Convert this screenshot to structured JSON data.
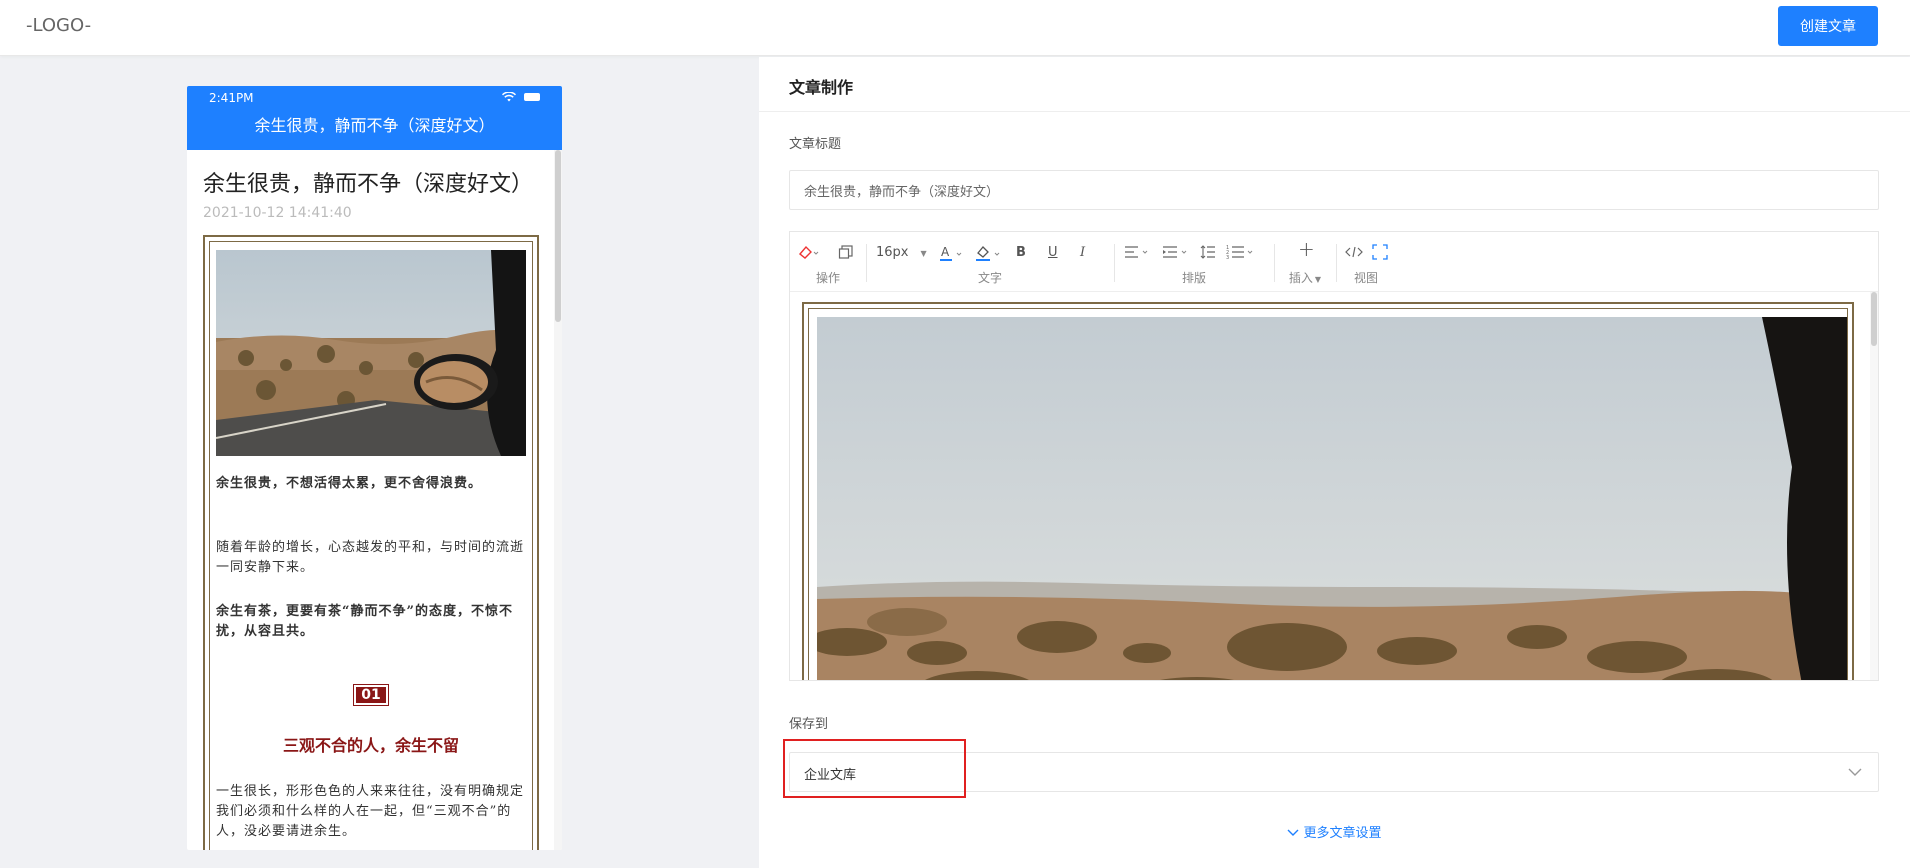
{
  "header": {
    "logo": "-LOGO-",
    "create_button": "创建文章"
  },
  "phone": {
    "status_time": "2:41PM",
    "nav_title": "余生很贵，静而不争（深度好文）",
    "article": {
      "title": "余生很贵，静而不争（深度好文）",
      "date": "2021-10-12 14:41:40",
      "p1": "余生很贵，不想活得太累，更不舍得浪费。",
      "p2": "随着年龄的增长，心态越发的平和，与时间的流逝一同安静下来。",
      "p3": "余生有茶，更要有茶“静而不争”的态度，不惊不扰，从容且共。",
      "section_number": "01",
      "section_title": "三观不合的人，余生不留",
      "p4": "一生很长，形形色色的人来来往往，没有明确规定我们必须和什么样的人在一起，但“三观不合”的人，没必要请进余生。"
    }
  },
  "panel": {
    "title": "文章制作",
    "title_label": "文章标题",
    "title_value": "余生很贵，静而不争（深度好文）",
    "toolbar": {
      "groups": {
        "operate": "操作",
        "text": "文字",
        "layout": "排版",
        "insert": "插入",
        "view": "视图"
      },
      "font_size": "16px",
      "bold": "B",
      "underline": "U",
      "italic": "I",
      "plus": "+"
    },
    "save_label": "保存到",
    "save_value": "企业文库",
    "more_settings": "更多文章设置"
  },
  "colors": {
    "primary": "#1e80ff",
    "frame": "#7d6a45",
    "accent_red": "#8a1616",
    "highlight": "#e02020"
  }
}
